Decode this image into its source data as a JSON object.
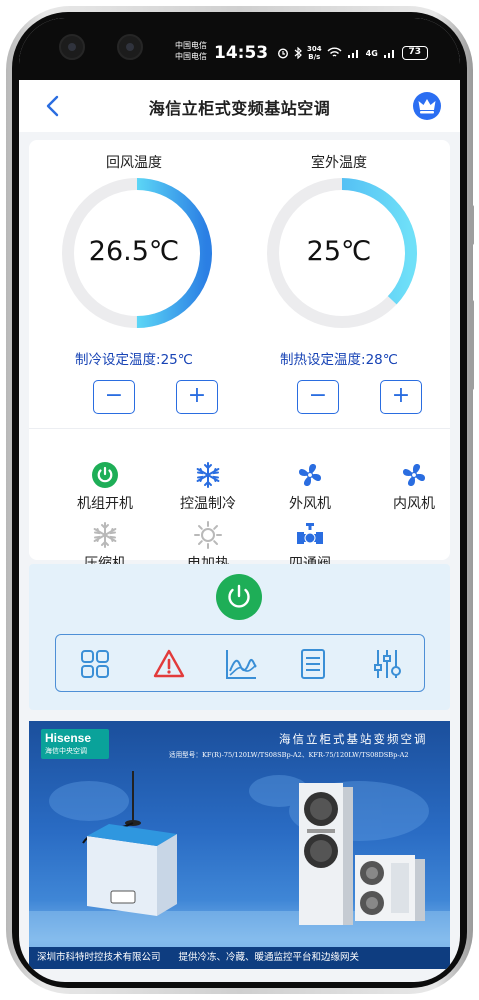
{
  "status_bar": {
    "carrier_1": "中国电信",
    "carrier_2": "中国电信",
    "time": "14:53",
    "net_speed_value": "304",
    "net_speed_unit": "B/s",
    "network": "4G",
    "battery": "73"
  },
  "app_bar": {
    "title": "海信立柜式变频基站空调"
  },
  "gauges": [
    {
      "label": "回风温度",
      "value": "26.5℃",
      "setpoint": "制冷设定温度:25℃",
      "fill_fraction": 0.5
    },
    {
      "label": "室外温度",
      "value": "25℃",
      "setpoint": "制热设定温度:28℃",
      "fill_fraction": 0.37
    }
  ],
  "stepper": {
    "minus": "−",
    "plus": "+"
  },
  "status_items": [
    {
      "label": "机组开机",
      "icon": "power-on-icon"
    },
    {
      "label": "控温制冷",
      "icon": "snowflake-icon"
    },
    {
      "label": "外风机",
      "icon": "fan-icon"
    },
    {
      "label": "内风机",
      "icon": "fan-icon"
    },
    {
      "label": "压缩机",
      "icon": "snowflake-icon"
    },
    {
      "label": "电加热",
      "icon": "sun-icon"
    },
    {
      "label": "四通阀",
      "icon": "valve-icon"
    }
  ],
  "colors": {
    "accent_blue": "#2a6de0",
    "gauge_cyan": "#57d4f5",
    "power_green": "#1eae57",
    "alarm_red": "#e23b3b",
    "inactive_grey": "#b9b9b9",
    "panel_bg": "#e4f1fa"
  },
  "banner": {
    "brand": "Hisense",
    "brand_sub": "海信中央空调",
    "title": "海信立柜式基站变频空调",
    "models": "适用型号：KF(R)-75/120LW/TS08SBp-A2、KFR-75/120LW/TS08DSBp-A2",
    "footer_company": "深圳市科特时控技术有限公司",
    "footer_slogan": "提供冷冻、冷藏、暖通监控平台和边缘网关"
  }
}
